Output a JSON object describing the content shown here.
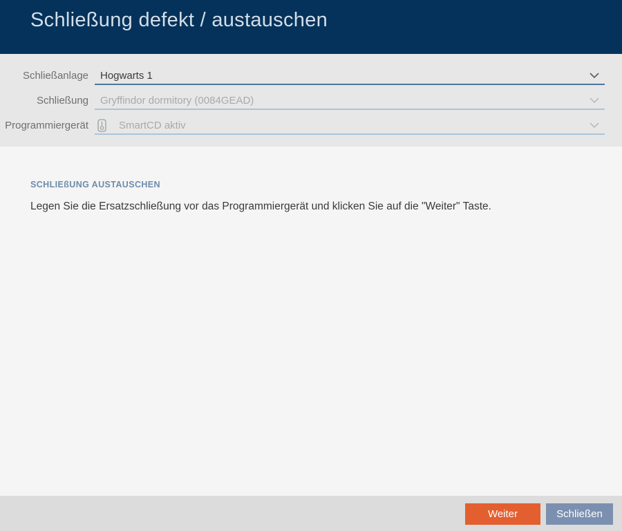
{
  "dialog": {
    "title": "Schließung defekt / austauschen"
  },
  "form": {
    "fields": [
      {
        "label": "Schließanlage",
        "value": "Hogwarts 1",
        "state": "enabled",
        "control": "dropdown"
      },
      {
        "label": "Schließung",
        "value": "Gryffindor dormitory (0084GEAD)",
        "state": "disabled",
        "control": "dropdown"
      },
      {
        "label": "Programmiergerät",
        "value": "SmartCD aktiv",
        "state": "disabled",
        "control": "dropdown",
        "icon": "programmer-device-icon"
      }
    ]
  },
  "content": {
    "section_heading": "SCHLIEßUNG AUSTAUSCHEN",
    "instruction": "Legen Sie die Ersatzschließung vor das Programmiergerät und klicken Sie auf die \"Weiter\" Taste."
  },
  "footer": {
    "next_label": "Weiter",
    "close_label": "Schließen"
  },
  "icons": {
    "dropdown": "chevron-down-icon",
    "programmer": "programmer-device-icon"
  },
  "colors": {
    "header_bg": "#04325a",
    "header_text": "#d4dee8",
    "form_bg": "#e7e7e7",
    "content_bg": "#f5f5f5",
    "footer_bg": "#dcdcdc",
    "underline_enabled": "#4f759c",
    "underline_disabled": "#adc3da",
    "accent_orange": "#e45f2f",
    "button_blue": "#7b90b0",
    "section_heading": "#6d8cac"
  }
}
